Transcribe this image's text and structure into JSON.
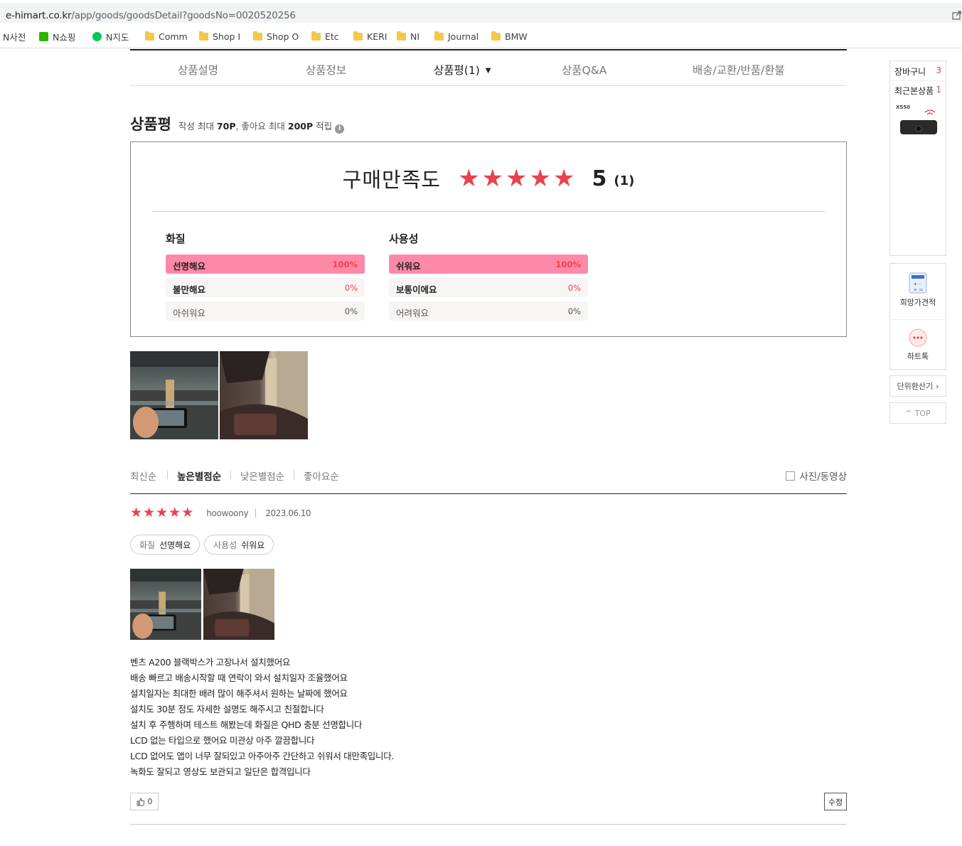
{
  "browser": {
    "url_host": "e-himart.co.kr",
    "url_path": "/app/goods/goodsDetail?goodsNo=0020520256"
  },
  "bookmarks": [
    {
      "label": "N사전",
      "icon": "none"
    },
    {
      "label": "N쇼핑",
      "icon": "naver-shopping-icon"
    },
    {
      "label": "N지도",
      "icon": "naver-map-icon"
    },
    {
      "label": "Comm",
      "icon": "folder-icon"
    },
    {
      "label": "Shop I",
      "icon": "folder-icon"
    },
    {
      "label": "Shop O",
      "icon": "folder-icon"
    },
    {
      "label": "Etc",
      "icon": "folder-icon"
    },
    {
      "label": "KERI",
      "icon": "folder-icon"
    },
    {
      "label": "NI",
      "icon": "folder-icon"
    },
    {
      "label": "Journal",
      "icon": "folder-icon"
    },
    {
      "label": "BMW",
      "icon": "folder-icon"
    }
  ],
  "tabs": [
    "상품설명",
    "상품정보",
    "상품평(1)",
    "상품Q&A",
    "배송/교환/반품/환불"
  ],
  "review_section": {
    "title": "상품평",
    "note_parts": [
      "작성 최대 ",
      "70P",
      ", 좋아요 최대 ",
      "200P",
      " 적립"
    ],
    "info_icon": "i"
  },
  "satisfaction": {
    "label": "구매만족도",
    "stars": 5,
    "score": "5",
    "count": "(1)"
  },
  "attributes": [
    {
      "title": "화질",
      "rows": [
        {
          "label": "선명해요",
          "percent": "100%",
          "fill": 1.0
        },
        {
          "label": "불만해요",
          "percent": "0%",
          "fill": 0
        },
        {
          "label": "아쉬워요",
          "percent": "0%",
          "fill": 0
        }
      ]
    },
    {
      "title": "사용성",
      "rows": [
        {
          "label": "쉬워요",
          "percent": "100%",
          "fill": 1.0
        },
        {
          "label": "보통이에요",
          "percent": "0%",
          "fill": 0
        },
        {
          "label": "어려워요",
          "percent": "0%",
          "fill": 0
        }
      ]
    }
  ],
  "sort_options": [
    "최신순",
    "높은별점순",
    "낮은별점순",
    "좋아요순"
  ],
  "sort_active": "높은별점순",
  "photo_filter_label": "사진/동영상",
  "review": {
    "stars": 5,
    "user": "hoowoony",
    "date": "2023.06.10",
    "chips": [
      {
        "key": "화질",
        "value": "선명해요"
      },
      {
        "key": "사용성",
        "value": "쉬워요"
      }
    ],
    "text": [
      "벤츠 A200 블랙박스가 고장나서 설치했어요",
      "배송 빠르고 배송시작할 때 연락이 와서 설치일자 조율했어요",
      "설치일자는 최대한 배려 많이 해주셔서 원하는 날짜에 했어요",
      "설치도 30분 정도 자세한 설명도 해주시고 친절합니다",
      "설치 후 주행하며 테스트 해봤는데 화질은 QHD 충분 선명합니다",
      "LCD 없는 타입으로 했어요 미관상 아주 깔끔합니다",
      "LCD 없어도 앱이 너무 잘되있고 아주아주 간단하고 쉬워서 대만족입니다.",
      "녹화도 잘되고 영상도 보관되고 일단은 합격입니다"
    ],
    "like_count": "0",
    "edit_label": "수정"
  },
  "sidebar": {
    "cart_label": "장바구니",
    "cart_count": "3",
    "recent_label": "최근본상품",
    "recent_count": "1",
    "recent_product_text": "X550",
    "price_quote_label": "희망가견적",
    "chat_label": "하트톡",
    "unit_converter_label": "단위환산기",
    "top_label": "TOP"
  },
  "colors": {
    "accent_red": "#e8424f",
    "bar_pink": "#fe88a8"
  }
}
